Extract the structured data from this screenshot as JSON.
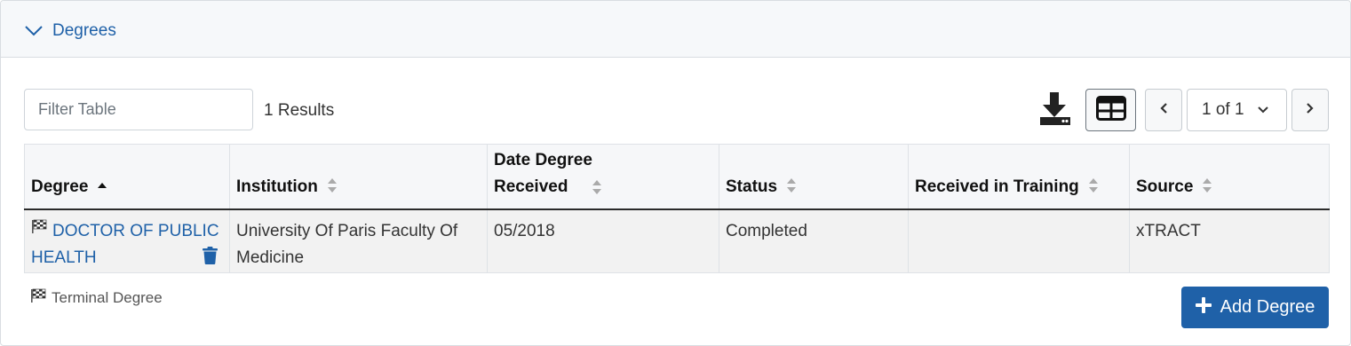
{
  "panel": {
    "title": "Degrees"
  },
  "toolbar": {
    "filter_placeholder": "Filter Table",
    "results_text": "1 Results",
    "pagination_label": "1 of 1"
  },
  "table": {
    "columns": [
      {
        "label": "Degree",
        "sort": "asc"
      },
      {
        "label": "Institution",
        "sort": "none"
      },
      {
        "label": "Date Degree Received",
        "sort": "none"
      },
      {
        "label": "Status",
        "sort": "none"
      },
      {
        "label": "Received in Training",
        "sort": "none"
      },
      {
        "label": "Source",
        "sort": "none"
      }
    ],
    "rows": [
      {
        "degree": "DOCTOR OF PUBLIC HEALTH",
        "institution": "University Of Paris Faculty Of Medicine",
        "date_received": "05/2018",
        "status": "Completed",
        "received_in_training": "",
        "source": "xTRACT"
      }
    ]
  },
  "legend": {
    "terminal_degree": "Terminal Degree"
  },
  "actions": {
    "add_degree": "Add Degree"
  },
  "colors": {
    "accent": "#1f61a8",
    "header_bg": "#f6f8fa",
    "row_bg": "#f2f2f2"
  },
  "icons": {
    "toggle": "chevron-down-icon",
    "download": "download-icon",
    "view": "table-view-icon",
    "prev": "chevron-left-icon",
    "next": "chevron-right-icon",
    "terminal": "checkered-flag-icon",
    "delete": "trash-icon",
    "add": "plus-icon"
  }
}
